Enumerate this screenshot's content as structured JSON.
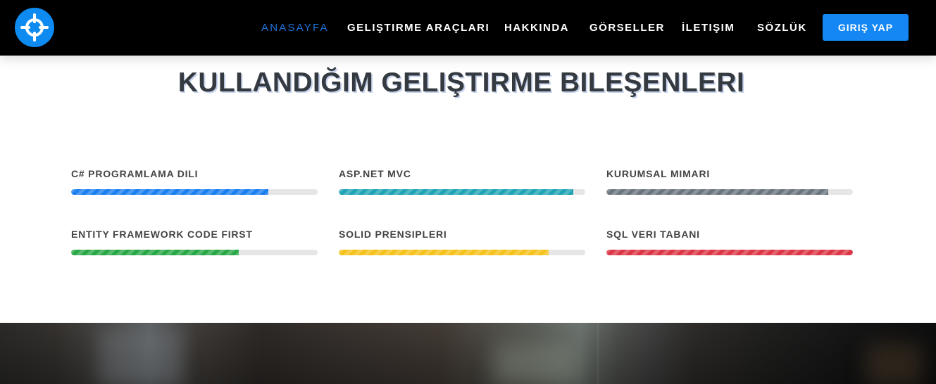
{
  "nav": {
    "logo_icon": "crosshair-icon",
    "items": [
      {
        "label": "ANASAYFA",
        "active": true
      },
      {
        "label": "GELIŞTIRME ARAÇLARI",
        "active": false
      },
      {
        "label": "HAKKINDA",
        "active": false
      },
      {
        "label": "GÖRSELLER",
        "active": false
      },
      {
        "label": "İLETIŞIM",
        "active": false
      },
      {
        "label": "SÖZLÜK",
        "active": false
      }
    ],
    "login_label": "GIRIŞ YAP"
  },
  "section": {
    "title": "KULLANDIĞIM GELIŞTIRME BILEŞENLERI"
  },
  "skills": [
    {
      "label": "C# PROGRAMLAMA DILI",
      "percent": 80,
      "color": "#1a7ff0"
    },
    {
      "label": "ASP.NET MVC",
      "percent": 95,
      "color": "#1fa3b5"
    },
    {
      "label": "KURUMSAL MIMARI",
      "percent": 90,
      "color": "#6c757d"
    },
    {
      "label": "ENTITY FRAMEWORK CODE FIRST",
      "percent": 68,
      "color": "#28a745"
    },
    {
      "label": "SOLID PRENSIPLERI",
      "percent": 85,
      "color": "#f5c11a"
    },
    {
      "label": "SQL VERI TABANI",
      "percent": 100,
      "color": "#dc3545"
    }
  ],
  "colors": {
    "nav_bg": "#000000",
    "accent": "#1487f5",
    "active_link": "#1e73d8"
  }
}
